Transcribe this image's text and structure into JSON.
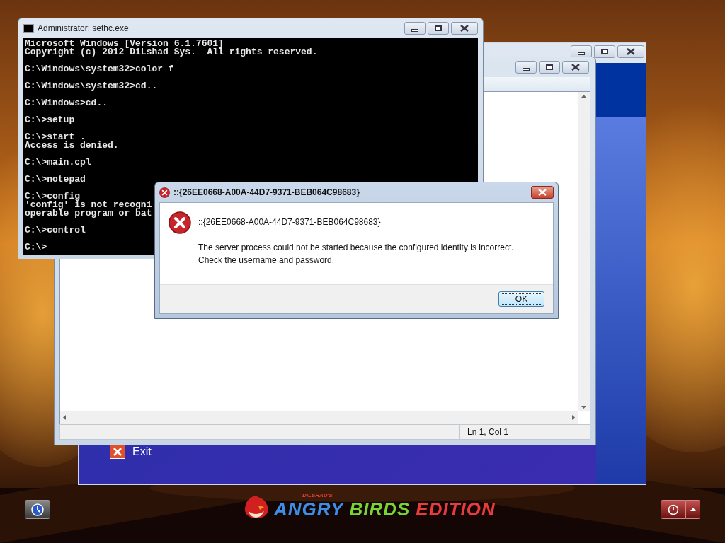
{
  "cmd_window": {
    "title": "Administrator: sethc.exe",
    "blocks": [
      [
        "Microsoft Windows [Version 6.1.7601]",
        "Copyright (c) 2012 DiLshad Sys.  All rights reserved."
      ],
      [
        "C:\\Windows\\system32>color f"
      ],
      [
        "C:\\Windows\\system32>cd.."
      ],
      [
        "C:\\Windows>cd.."
      ],
      [
        "C:\\>setup"
      ],
      [
        "C:\\>start .",
        "Access is denied."
      ],
      [
        "C:\\>main.cpl"
      ],
      [
        "C:\\>notepad"
      ],
      [
        "C:\\>config",
        "'config' is not recogni",
        "operable program or bat"
      ],
      [
        "C:\\>control"
      ],
      [
        "C:\\>"
      ]
    ]
  },
  "back_window": {
    "menu_item": "Exit"
  },
  "notepad": {
    "status": "Ln 1, Col 1"
  },
  "dialog": {
    "title": "::{26EE0668-A00A-44D7-9371-BEB064C98683}",
    "heading": "::{26EE0668-A00A-44D7-9371-BEB064C98683}",
    "message": [
      "The server process could not be started because the configured identity is incorrect.",
      "Check the username and password."
    ],
    "button": "OK"
  },
  "branding": {
    "small": "DILSHAD'S",
    "words": [
      {
        "text": "ANGRY",
        "color": "#3d8ee8"
      },
      {
        "text": "BIRDS",
        "color": "#7ad532"
      },
      {
        "text": "EDITION",
        "color": "#e83c3c"
      }
    ]
  }
}
